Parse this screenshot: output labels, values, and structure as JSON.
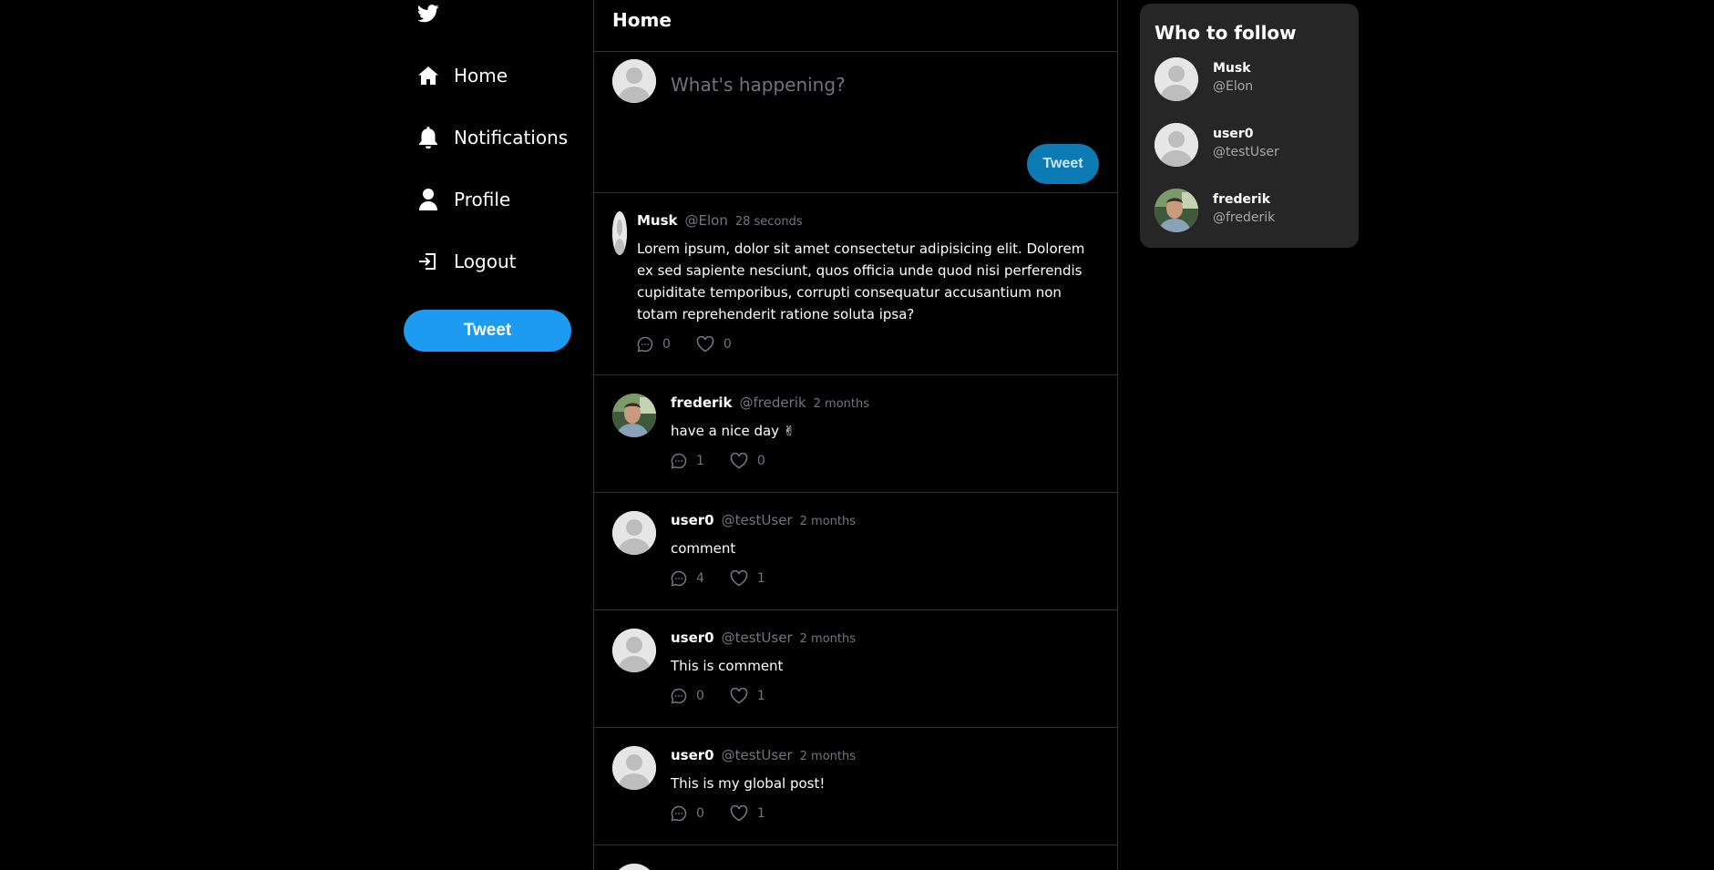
{
  "sidebar": {
    "logo": "twitter-bird-icon",
    "nav": [
      {
        "label": "Home",
        "icon": "home-icon"
      },
      {
        "label": "Notifications",
        "icon": "bell-icon"
      },
      {
        "label": "Profile",
        "icon": "person-icon"
      },
      {
        "label": "Logout",
        "icon": "logout-icon"
      }
    ],
    "tweet_button": "Tweet"
  },
  "feed": {
    "title": "Home",
    "composer": {
      "placeholder": "What's happening?",
      "tweet_button": "Tweet"
    },
    "tweets": [
      {
        "name": "Musk",
        "handle": "@Elon",
        "time": "28 seconds",
        "text": "Lorem ipsum, dolor sit amet consectetur adipisicing elit. Dolorem ex sed sapiente nesciunt, quos officia unde quod nisi perferendis cupiditate temporibus, corrupti consequatur accusantium non totam reprehenderit ratione soluta ipsa?",
        "comments": "0",
        "likes": "0"
      },
      {
        "name": "frederik",
        "handle": "@frederik",
        "time": "2 months",
        "text": "have a nice day ✌",
        "comments": "1",
        "likes": "0"
      },
      {
        "name": "user0",
        "handle": "@testUser",
        "time": "2 months",
        "text": "comment",
        "comments": "4",
        "likes": "1"
      },
      {
        "name": "user0",
        "handle": "@testUser",
        "time": "2 months",
        "text": "This is comment",
        "comments": "0",
        "likes": "1"
      },
      {
        "name": "user0",
        "handle": "@testUser",
        "time": "2 months",
        "text": "This is my global post!",
        "comments": "0",
        "likes": "1"
      }
    ]
  },
  "who_to_follow": {
    "title": "Who to follow",
    "users": [
      {
        "name": "Musk",
        "handle": "@Elon"
      },
      {
        "name": "user0",
        "handle": "@testUser"
      },
      {
        "name": "frederik",
        "handle": "@frederik"
      }
    ]
  },
  "colors": {
    "background": "#000000",
    "accent": "#1d9bf0",
    "card": "#262626",
    "border": "#2f3336",
    "muted": "#71767b"
  }
}
